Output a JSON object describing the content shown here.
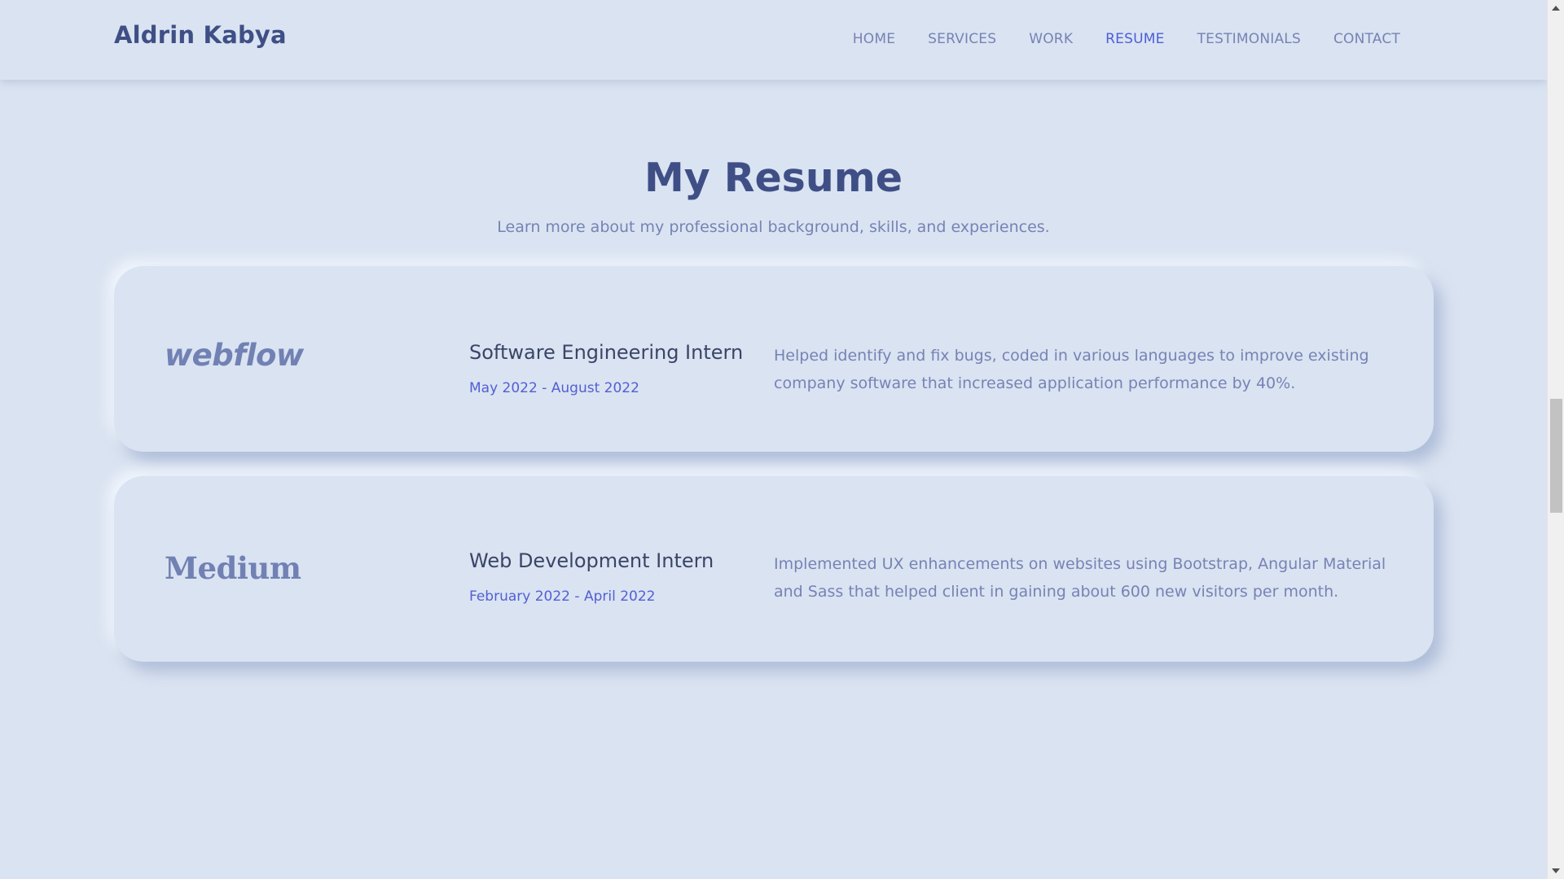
{
  "header": {
    "brand": "Aldrin Kabya",
    "nav": [
      {
        "label": "HOME",
        "active": false
      },
      {
        "label": "SERVICES",
        "active": false
      },
      {
        "label": "WORK",
        "active": false
      },
      {
        "label": "RESUME",
        "active": true
      },
      {
        "label": "TESTIMONIALS",
        "active": false
      },
      {
        "label": "CONTACT",
        "active": false
      }
    ]
  },
  "resume": {
    "title": "My Resume",
    "subtitle": "Learn more about my professional background, skills, and experiences.",
    "entries": [
      {
        "company_logo_text": "webflow",
        "role": "Software Engineering Intern",
        "dates": "May 2022 - August 2022",
        "description": "Helped identify and fix bugs, coded in various languages to improve existing company software that increased application performance by 40%."
      },
      {
        "company_logo_text": "Medium",
        "role": "Web Development Intern",
        "dates": "February 2022 - April 2022",
        "description": "Implemented UX enhancements on websites using Bootstrap, Angular Material and Sass that helped client in gaining about 600 new visitors per month."
      }
    ]
  },
  "colors": {
    "background": "#dae3f1",
    "heading": "#3f4f86",
    "muted_text": "#7683b5",
    "accent": "#5260d4",
    "nav_active": "#4d5fd6"
  },
  "scrollbar": {
    "up_icon": "scroll-up-arrow-icon",
    "down_icon": "scroll-down-arrow-icon"
  }
}
